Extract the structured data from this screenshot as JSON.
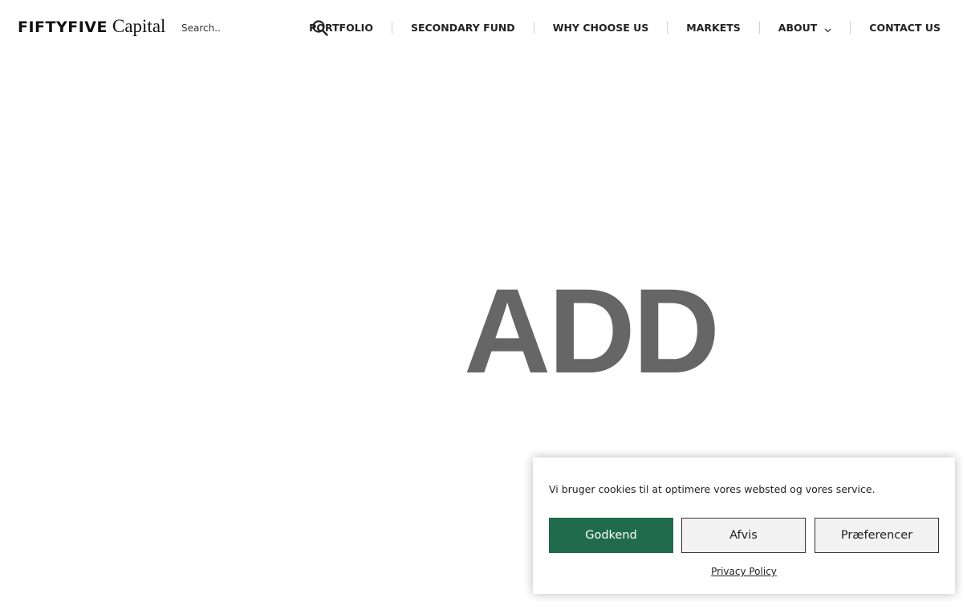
{
  "header": {
    "logo": {
      "wordmark": "FIFTYFIVE",
      "suffix": "Capital"
    },
    "search": {
      "placeholder": "Search..",
      "icon": "search-icon"
    },
    "nav": {
      "items": [
        {
          "label": "PORTFOLIO"
        },
        {
          "label": "SECONDARY FUND"
        },
        {
          "label": "WHY CHOOSE US"
        },
        {
          "label": "MARKETS"
        },
        {
          "label": "ABOUT",
          "icon": "chevron-down-icon"
        },
        {
          "label": "CONTACT US"
        }
      ]
    }
  },
  "hero": {
    "text": "ADD",
    "color": "#666666"
  },
  "cookie_banner": {
    "message": "Vi bruger cookies til at optimere vores websted og vores service.",
    "accept_label": "Godkend",
    "deny_label": "Afvis",
    "preferences_label": "Præferencer",
    "privacy_link": "Privacy Policy",
    "accent_color": "#1f6b4b"
  }
}
